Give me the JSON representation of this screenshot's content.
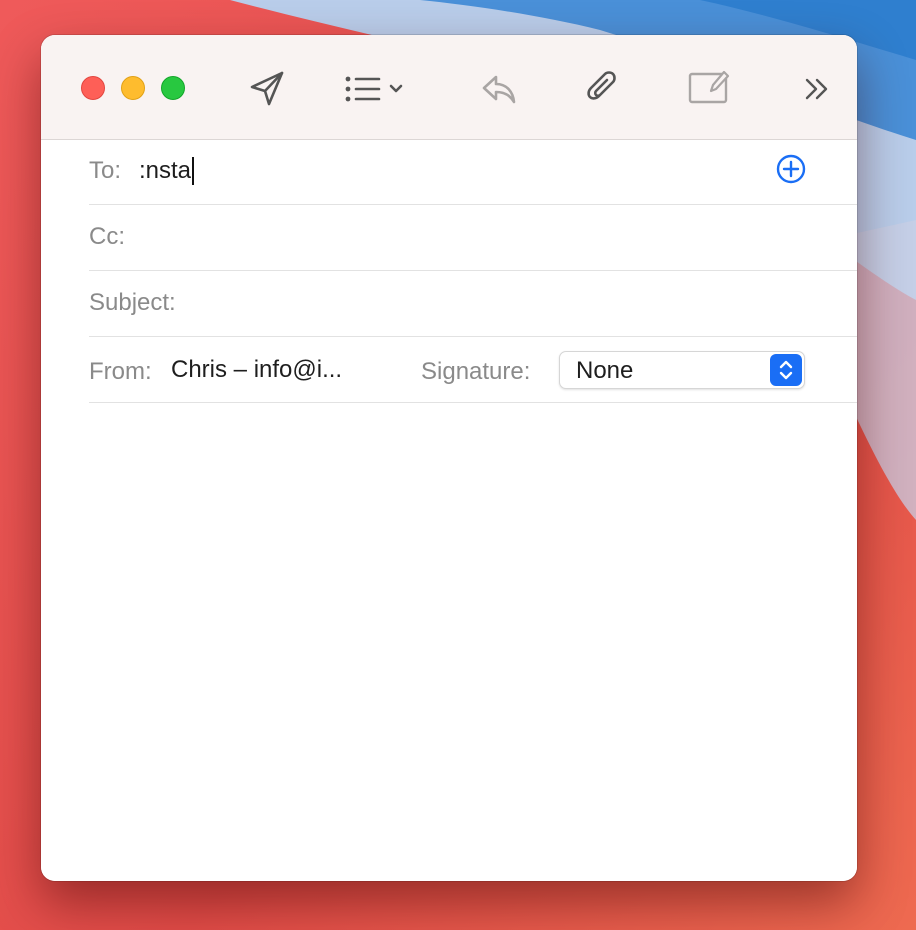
{
  "compose": {
    "to_label": "To:",
    "to_value": ":nsta",
    "cc_label": "Cc:",
    "subject_label": "Subject:",
    "from_label": "From:",
    "from_value": "Chris – info@i...",
    "signature_label": "Signature:",
    "signature_value": "None"
  },
  "toolbar": {
    "icons": [
      "send-icon",
      "format-list-icon",
      "reply-icon",
      "attachment-icon",
      "markup-icon",
      "overflow-chevron-icon"
    ]
  },
  "colors": {
    "accent": "#1a6ef5",
    "close": "#fe5f57",
    "minimize": "#febc2e",
    "zoom": "#28c840",
    "toolbar_bg": "#f9f3f2"
  }
}
